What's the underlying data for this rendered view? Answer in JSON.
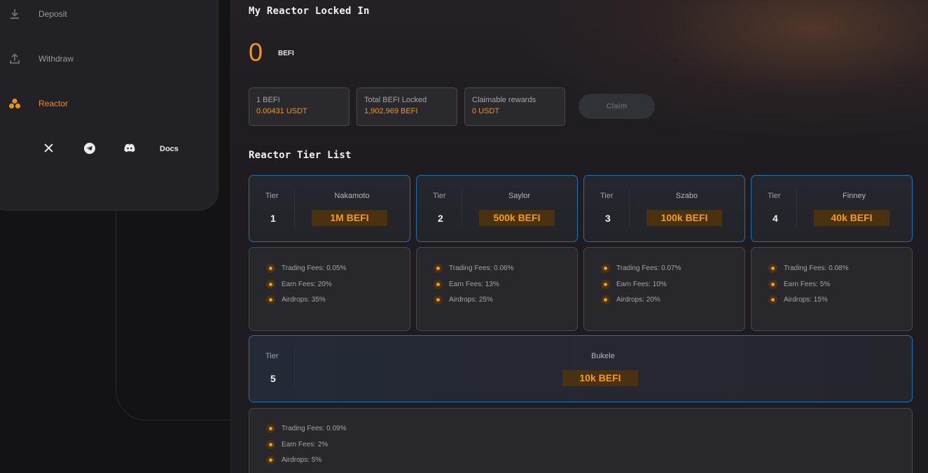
{
  "sidebar": {
    "items": [
      {
        "label": "Deposit",
        "icon": "download-icon"
      },
      {
        "label": "Withdraw",
        "icon": "upload-icon"
      },
      {
        "label": "Reactor",
        "icon": "reactor-icon"
      }
    ],
    "social": {
      "x": "x-icon",
      "telegram": "telegram-icon",
      "discord": "discord-icon",
      "docs_label": "Docs"
    }
  },
  "main": {
    "locked_title": "My Reactor Locked In",
    "locked_value": "0",
    "locked_unit": "BEFI",
    "stats": [
      {
        "label": "1 BEFI",
        "value": "0.00431 USDT"
      },
      {
        "label": "Total BEFI Locked",
        "value": "1,902,969 BEFI"
      },
      {
        "label": "Claimable rewards",
        "value": "0 USDT"
      }
    ],
    "claim_label": "Claim",
    "tier_list_title": "Reactor Tier List",
    "tier_label": "Tier",
    "tiers": [
      {
        "num": "1",
        "name": "Nakamoto",
        "amount": "1M BEFI",
        "perks": [
          "Trading Fees: 0.05%",
          "Earn Fees: 20%",
          "Airdrops: 35%"
        ]
      },
      {
        "num": "2",
        "name": "Saylor",
        "amount": "500k BEFI",
        "perks": [
          "Trading Fees: 0.06%",
          "Earn Fees: 13%",
          "Airdrops: 25%"
        ]
      },
      {
        "num": "3",
        "name": "Szabo",
        "amount": "100k BEFI",
        "perks": [
          "Trading Fees: 0.07%",
          "Earn Fees: 10%",
          "Airdrops: 20%"
        ]
      },
      {
        "num": "4",
        "name": "Finney",
        "amount": "40k BEFI",
        "perks": [
          "Trading Fees: 0.08%",
          "Earn Fees: 5%",
          "Airdrops: 15%"
        ]
      },
      {
        "num": "5",
        "name": "Bukele",
        "amount": "10k BEFI",
        "perks": [
          "Trading Fees: 0.09%",
          "Earn Fees: 2%",
          "Airdrops: 5%"
        ]
      }
    ]
  },
  "colors": {
    "accent": "#f0961f",
    "tier_border": "#1f6fb5",
    "amount_bg": "#4a3210"
  }
}
